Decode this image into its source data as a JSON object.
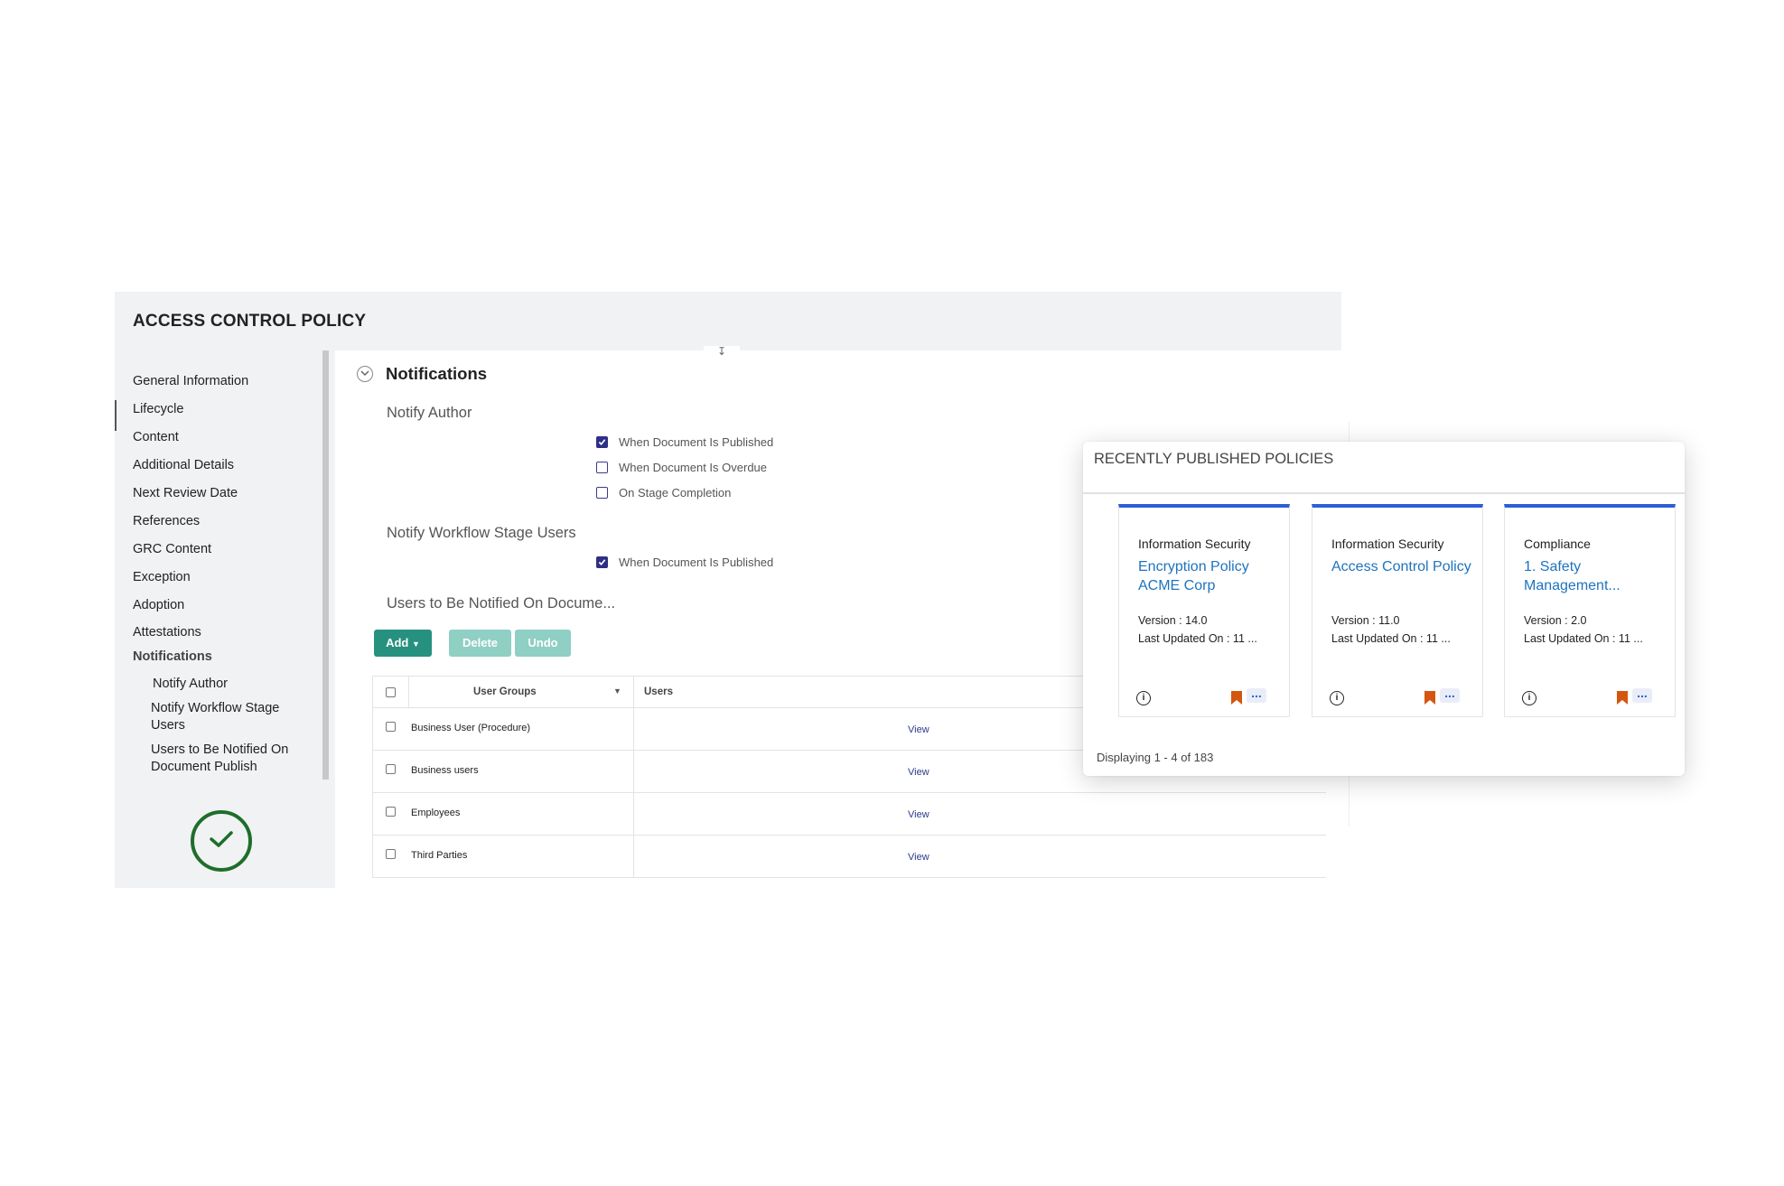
{
  "page": {
    "title": "ACCESS CONTROL POLICY"
  },
  "sidebar": {
    "items": [
      {
        "label": "General Information"
      },
      {
        "label": "Lifecycle"
      },
      {
        "label": "Content"
      },
      {
        "label": "Additional Details"
      },
      {
        "label": "Next Review Date"
      },
      {
        "label": "References"
      },
      {
        "label": "GRC Content"
      },
      {
        "label": "Exception"
      },
      {
        "label": "Adoption"
      },
      {
        "label": "Attestations"
      },
      {
        "label": "Notifications"
      }
    ],
    "sub_items": [
      {
        "label": "Notify Author"
      },
      {
        "label": "Notify Workflow Stage Users"
      },
      {
        "label": "Users to Be Notified On Document Publish"
      }
    ]
  },
  "notifications": {
    "section_title": "Notifications",
    "notify_author": {
      "heading": "Notify Author",
      "options": [
        {
          "label": "When Document Is Published",
          "checked": true
        },
        {
          "label": "When Document Is Overdue",
          "checked": false
        },
        {
          "label": "On Stage Completion",
          "checked": false
        }
      ]
    },
    "notify_workflow": {
      "heading": "Notify Workflow Stage Users",
      "options": [
        {
          "label": "When Document Is Published",
          "checked": true
        }
      ]
    },
    "users_heading": "Users to Be Notified On Docume..."
  },
  "toolbar": {
    "add_label": "Add",
    "delete_label": "Delete",
    "undo_label": "Undo"
  },
  "table": {
    "columns": [
      "User Groups",
      "Users"
    ],
    "rows": [
      {
        "group": "Business User (Procedure)",
        "action": "View"
      },
      {
        "group": "Business users",
        "action": "View"
      },
      {
        "group": "Employees",
        "action": "View"
      },
      {
        "group": "Third Parties",
        "action": "View"
      }
    ]
  },
  "popup": {
    "title": "RECENTLY PUBLISHED POLICIES",
    "cards": [
      {
        "category": "Information Security",
        "name": "Encryption Policy ACME Corp",
        "version": "Version : 14.0",
        "updated": "Last Updated On : 11 ..."
      },
      {
        "category": "Information Security",
        "name": "Access Control Policy",
        "version": "Version : 11.0",
        "updated": "Last Updated On : 11 ..."
      },
      {
        "category": "Compliance",
        "name": "1. Safety Management...",
        "version": "Version : 2.0",
        "updated": "Last Updated On : 11 ..."
      }
    ],
    "footer": "Displaying 1 - 4 of 183"
  },
  "colors": {
    "accent_teal": "#27917f",
    "card_top": "#2c5fd6",
    "link_blue": "#1e73be",
    "bookmark": "#d4560f",
    "check_green": "#1e6e2a"
  }
}
